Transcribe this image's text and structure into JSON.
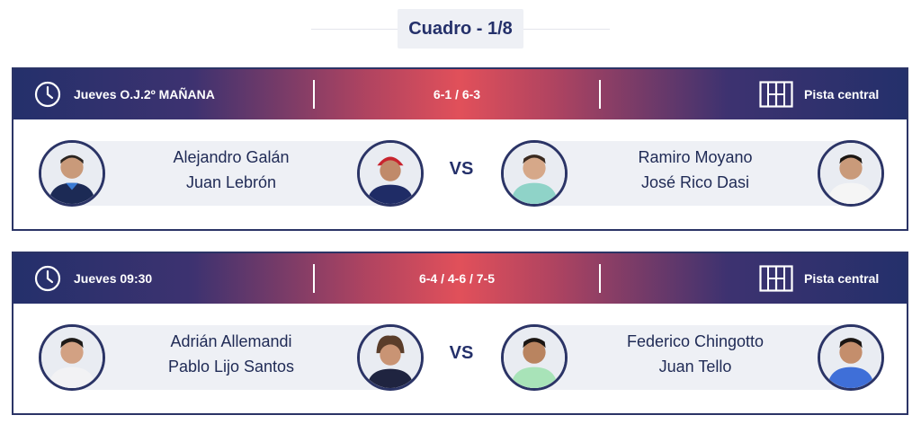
{
  "round": {
    "title": "Cuadro - 1/8"
  },
  "matches": [
    {
      "time": "Jueves O.J.2º MAÑANA",
      "score": "6-1 / 6-3",
      "court": "Pista central",
      "team1": {
        "player1": "Alejandro Galán",
        "player2": "Juan Lebrón"
      },
      "vs": "VS",
      "team2": {
        "player1": "Ramiro Moyano",
        "player2": "José Rico Dasi"
      }
    },
    {
      "time": "Jueves 09:30",
      "score": "6-4 / 4-6 / 7-5",
      "court": "Pista central",
      "team1": {
        "player1": "Adrián Allemandi",
        "player2": "Pablo Lijo Santos"
      },
      "vs": "VS",
      "team2": {
        "player1": "Federico Chingotto",
        "player2": "Juan Tello"
      }
    }
  ],
  "icons": {
    "time": "clock-icon",
    "court": "padel-court-icon"
  },
  "colors": {
    "navy": "#24306b",
    "accent": "#e1505a",
    "strip": "#eef0f5"
  }
}
